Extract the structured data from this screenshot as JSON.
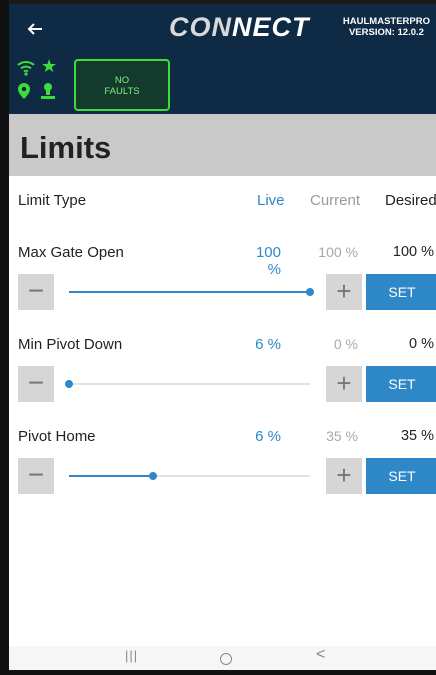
{
  "appbar": {
    "logo_left": "CON",
    "logo_right": "NECT",
    "version_line1": "HAULMASTERPRO",
    "version_line2": "VERSION: 12.0.2"
  },
  "status": {
    "faults_line1": "NO",
    "faults_line2": "FAULTS",
    "indicator_color": "#3ddc3d"
  },
  "page": {
    "title": "Limits"
  },
  "header": {
    "type": "Limit Type",
    "live": "Live",
    "current": "Current",
    "desired": "Desired"
  },
  "limits": [
    {
      "name": "Max Gate Open",
      "live": "100 %",
      "current": "100 %",
      "desired": "100 %",
      "slider_percent": 100,
      "minus": "−",
      "plus": "+",
      "set": "SET"
    },
    {
      "name": "Min Pivot Down",
      "live": "6 %",
      "current": "0 %",
      "desired": "0 %",
      "slider_percent": 0,
      "minus": "−",
      "plus": "+",
      "set": "SET"
    },
    {
      "name": "Pivot Home",
      "live": "6 %",
      "current": "35 %",
      "desired": "35 %",
      "slider_percent": 35,
      "minus": "−",
      "plus": "+",
      "set": "SET"
    }
  ],
  "navbar": {
    "recents": "|||",
    "back": "<"
  },
  "colors": {
    "brand": "#0f2a44",
    "accent": "#2e88c8",
    "header_band": "#c9c9c9"
  }
}
